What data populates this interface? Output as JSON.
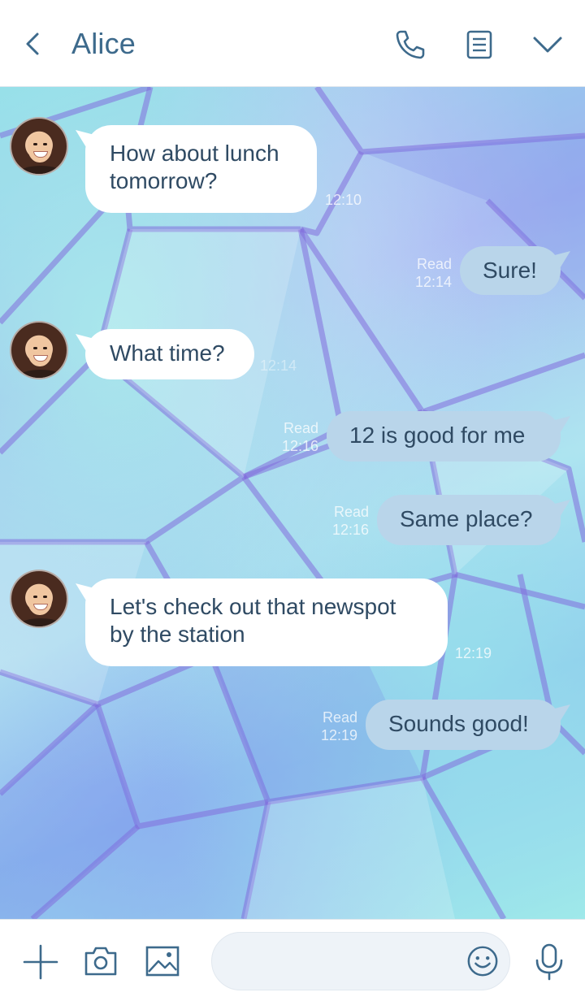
{
  "header": {
    "title": "Alice",
    "icons": [
      "back-chevron-icon",
      "phone-icon",
      "notes-icon",
      "chevron-down-icon"
    ]
  },
  "colors": {
    "accent": "#3d6a8c",
    "bubble_in": "#ffffff",
    "bubble_out": "#b9d5ea",
    "text": "#2f4a63"
  },
  "messages": [
    {
      "side": "in",
      "text": "How about lunch tomorrow?",
      "time": "12:10"
    },
    {
      "side": "out",
      "text": "Sure!",
      "status": "Read",
      "time": "12:14"
    },
    {
      "side": "in",
      "text": "What time?",
      "time": "12:14"
    },
    {
      "side": "out",
      "text": "12 is good for me",
      "status": "Read",
      "time": "12:16"
    },
    {
      "side": "out",
      "text": "Same place?",
      "status": "Read",
      "time": "12:16"
    },
    {
      "side": "in",
      "text": "Let's check out that newspot by the station",
      "time": "12:19"
    },
    {
      "side": "out",
      "text": "Sounds good!",
      "status": "Read",
      "time": "12:19"
    }
  ],
  "footer": {
    "icons": [
      "plus-icon",
      "camera-icon",
      "image-icon",
      "emoji-icon",
      "microphone-icon"
    ],
    "input_value": ""
  }
}
